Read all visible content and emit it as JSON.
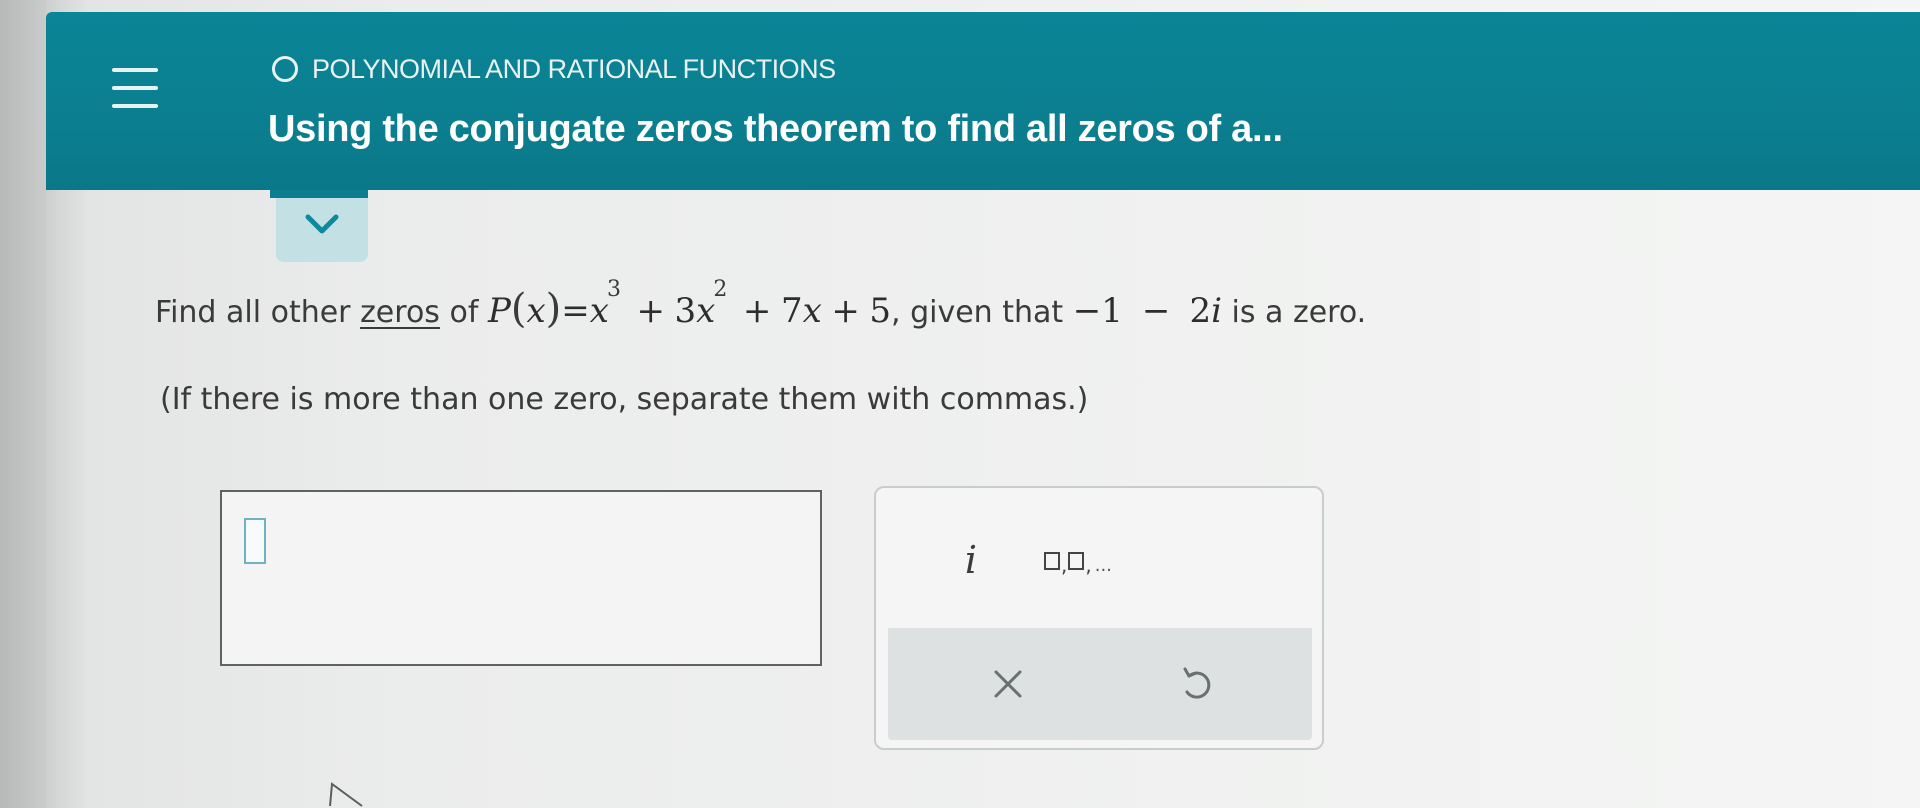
{
  "header": {
    "category": "POLYNOMIAL AND RATIONAL FUNCTIONS",
    "title": "Using the conjugate zeros theorem to find all zeros of a..."
  },
  "question": {
    "prefix": "Find all other",
    "zeros_link": "zeros",
    "of_text": "of",
    "fn_name": "P",
    "var": "x",
    "equals": "=",
    "term1_base": "x",
    "term1_exp": "3",
    "plus1": "+",
    "term2_coef": "3",
    "term2_base": "x",
    "term2_exp": "2",
    "plus2": "+",
    "term3_coef": "7",
    "term3_base": "x",
    "plus3": "+",
    "constant": "5",
    "given_text": ", given that",
    "zero_real": "−1",
    "minus": "−",
    "zero_imag_coef": "2",
    "zero_imag_unit": "i",
    "suffix": "is a zero."
  },
  "instruction": "(If there is more than one zero, separate them with commas.)",
  "keypad": {
    "i_key": "i",
    "list_sep": ",",
    "list_dots": "..."
  },
  "icons": {
    "menu": "hamburger-menu-icon",
    "expand": "chevron-down-icon",
    "clear": "close-icon",
    "undo": "undo-icon"
  },
  "colors": {
    "header_bg": "#0b7f90",
    "header_text": "#ffffff",
    "expand_bg": "#c3e1e4",
    "cursor_border": "#6fb2c4"
  }
}
